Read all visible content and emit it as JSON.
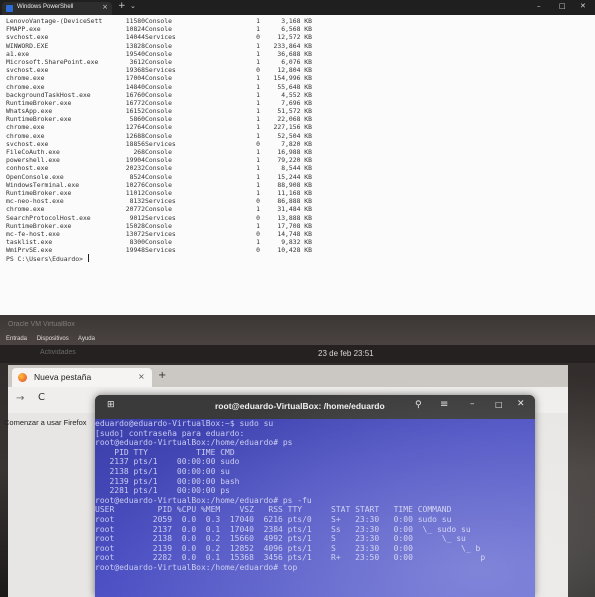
{
  "powershell": {
    "tab_title": "Windows PowerShell",
    "tab_close": "×",
    "new_tab": "+",
    "dropdown": "⌄",
    "window_controls": {
      "minimize": "–",
      "maximize": "□",
      "close": "✕"
    },
    "processes": [
      [
        "LenovoVantage-(DeviceSett",
        "11580",
        "Console",
        "1",
        "3,168 KB"
      ],
      [
        "FMAPP.exe",
        "10824",
        "Console",
        "1",
        "6,568 KB"
      ],
      [
        "svchost.exe",
        "14044",
        "Services",
        "0",
        "12,572 KB"
      ],
      [
        "WINWORD.EXE",
        "13828",
        "Console",
        "1",
        "233,864 KB"
      ],
      [
        "a1.exe",
        "19540",
        "Console",
        "1",
        "36,688 KB"
      ],
      [
        "Microsoft.SharePoint.exe",
        "3612",
        "Console",
        "1",
        "6,076 KB"
      ],
      [
        "svchost.exe",
        "19368",
        "Services",
        "0",
        "12,804 KB"
      ],
      [
        "chrome.exe",
        "17004",
        "Console",
        "1",
        "154,996 KB"
      ],
      [
        "chrome.exe",
        "14840",
        "Console",
        "1",
        "55,648 KB"
      ],
      [
        "backgroundTaskHost.exe",
        "16760",
        "Console",
        "1",
        "4,552 KB"
      ],
      [
        "RuntimeBroker.exe",
        "16772",
        "Console",
        "1",
        "7,696 KB"
      ],
      [
        "WhatsApp.exe",
        "16152",
        "Console",
        "1",
        "51,572 KB"
      ],
      [
        "RuntimeBroker.exe",
        "5860",
        "Console",
        "1",
        "22,068 KB"
      ],
      [
        "chrome.exe",
        "12764",
        "Console",
        "1",
        "227,156 KB"
      ],
      [
        "chrome.exe",
        "12688",
        "Console",
        "1",
        "52,504 KB"
      ],
      [
        "svchost.exe",
        "18856",
        "Services",
        "0",
        "7,820 KB"
      ],
      [
        "FileCoAuth.exe",
        "268",
        "Console",
        "1",
        "16,988 KB"
      ],
      [
        "powershell.exe",
        "19904",
        "Console",
        "1",
        "79,220 KB"
      ],
      [
        "conhost.exe",
        "20232",
        "Console",
        "1",
        "8,544 KB"
      ],
      [
        "OpenConsole.exe",
        "8524",
        "Console",
        "1",
        "15,244 KB"
      ],
      [
        "WindowsTerminal.exe",
        "10276",
        "Console",
        "1",
        "88,908 KB"
      ],
      [
        "RuntimeBroker.exe",
        "11012",
        "Console",
        "1",
        "11,168 KB"
      ],
      [
        "mc-neo-host.exe",
        "8132",
        "Services",
        "0",
        "86,888 KB"
      ],
      [
        "chrome.exe",
        "20772",
        "Console",
        "1",
        "31,484 KB"
      ],
      [
        "SearchProtocolHost.exe",
        "9012",
        "Services",
        "0",
        "13,888 KB"
      ],
      [
        "RuntimeBroker.exe",
        "15028",
        "Console",
        "1",
        "17,708 KB"
      ],
      [
        "mc-fe-host.exe",
        "13072",
        "Services",
        "0",
        "14,748 KB"
      ],
      [
        "tasklist.exe",
        "8300",
        "Console",
        "1",
        "9,832 KB"
      ],
      [
        "WmiPrvSE.exe",
        "19948",
        "Services",
        "0",
        "10,428 KB"
      ]
    ],
    "prompt": "PS C:\\Users\\Eduardo> "
  },
  "photo": {
    "vbox_title": "Oracle VM VirtualBox",
    "vbox_menu": [
      "Entrada",
      "Dispositivos",
      "Ayuda"
    ],
    "activities": "Actividades",
    "clock": "23 de feb  23:51",
    "firefox": {
      "tab_label": "Nueva pestaña",
      "tab_close": "×",
      "new_tab": "+",
      "back": "→",
      "reload": "C",
      "page_text": "Comenzar a usar Firefox"
    },
    "terminal": {
      "new_tab": "⊞",
      "title": "root@eduardo-VirtualBox: /home/eduardo",
      "search": "⚲",
      "menu": "≡",
      "minimize": "–",
      "maximize": "□",
      "close": "✕",
      "lines": [
        "eduardo@eduardo-VirtualBox:~$ sudo su",
        "[sudo] contraseña para eduardo:",
        "root@eduardo-VirtualBox:/home/eduardo# ps",
        "    PID TTY          TIME CMD",
        "   2137 pts/1    00:00:00 sudo",
        "   2138 pts/1    00:00:00 su",
        "   2139 pts/1    00:00:00 bash",
        "   2281 pts/1    00:00:00 ps",
        "root@eduardo-VirtualBox:/home/eduardo# ps -fu",
        "USER         PID %CPU %MEM    VSZ   RSS TTY      STAT START   TIME COMMAND",
        "root        2059  0.0  0.3  17040  6216 pts/0    S+   23:30   0:00 sudo su",
        "root        2137  0.0  0.1  17040  2384 pts/1    Ss   23:30   0:00  \\_ sudo su",
        "root        2138  0.0  0.2  15660  4992 pts/1    S    23:30   0:00      \\_ su",
        "root        2139  0.0  0.2  12852  4096 pts/1    S    23:30   0:00          \\_ b",
        "root        2282  0.0  0.1  15368  3456 pts/1    R+   23:50   0:00              p",
        "root@eduardo-VirtualBox:/home/eduardo# top"
      ]
    }
  }
}
